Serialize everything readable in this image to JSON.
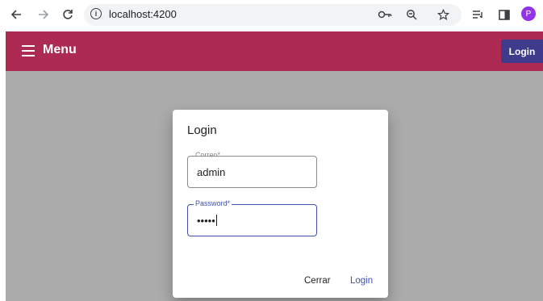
{
  "browser": {
    "url": "localhost:4200",
    "info_glyph": "i",
    "profile_initial": "P",
    "icons": [
      "back-arrow-icon",
      "forward-arrow-icon",
      "reload-icon",
      "site-info-icon",
      "password-key-icon",
      "zoom-icon",
      "bookmark-star-icon",
      "reading-list-icon",
      "side-panel-icon"
    ]
  },
  "toolbar": {
    "menu_label": "Menu",
    "login_label": "Login",
    "background_color": "#ad2a53",
    "login_button_color": "#3f3b8c"
  },
  "dialog": {
    "title": "Login",
    "email": {
      "label": "Correo*",
      "value": "admin"
    },
    "password": {
      "label": "Password*",
      "value": "•••••"
    },
    "actions": {
      "close_label": "Cerrar",
      "login_label": "Login"
    },
    "accent_color": "#3f51b5"
  }
}
